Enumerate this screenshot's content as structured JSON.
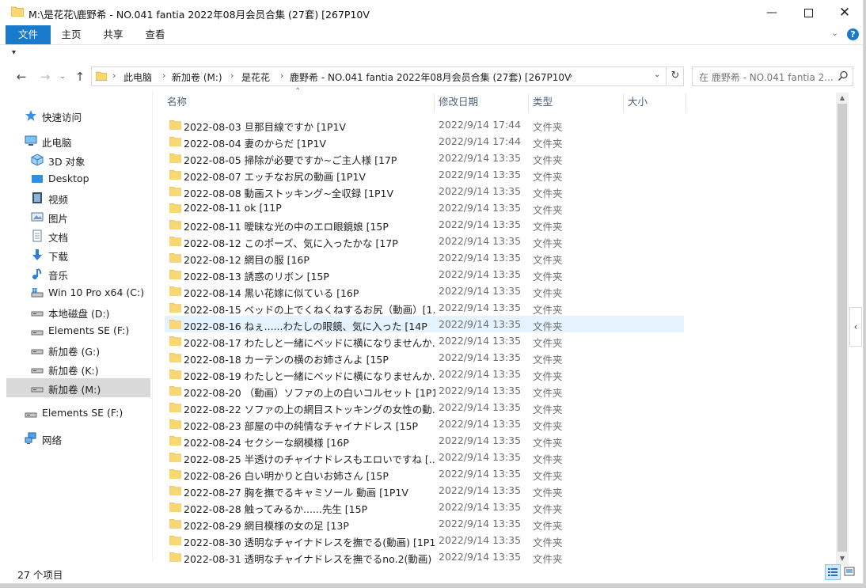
{
  "window": {
    "title": "M:\\是花花\\鹿野希 - NO.041 fantia 2022年08月会员合集 (27套) [267P10V"
  },
  "ribbon": {
    "tabs": [
      "文件",
      "主页",
      "共享",
      "查看"
    ],
    "accent_color": "#1979ca"
  },
  "address": {
    "crumbs": [
      "此电脑",
      "新加卷 (M:)",
      "是花花",
      "鹿野希 - NO.041 fantia 2022年08月会员合集 (27套) [267P10V"
    ]
  },
  "search": {
    "placeholder": "在 鹿野希 - NO.041 fantia 2..."
  },
  "sidebar": {
    "items": [
      {
        "label": "快速访问",
        "icon": "star-icon"
      },
      {
        "label": "此电脑",
        "icon": "computer-icon"
      },
      {
        "label": "3D 对象",
        "icon": "cube-icon"
      },
      {
        "label": "Desktop",
        "icon": "desktop-icon"
      },
      {
        "label": "视频",
        "icon": "video-icon"
      },
      {
        "label": "图片",
        "icon": "picture-icon"
      },
      {
        "label": "文档",
        "icon": "document-icon"
      },
      {
        "label": "下载",
        "icon": "download-icon"
      },
      {
        "label": "音乐",
        "icon": "music-icon"
      },
      {
        "label": "Win 10 Pro x64 (C:)",
        "icon": "system-drive-icon"
      },
      {
        "label": "本地磁盘 (D:)",
        "icon": "drive-icon"
      },
      {
        "label": "Elements SE (F:)",
        "icon": "drive-icon"
      },
      {
        "label": "新加卷 (G:)",
        "icon": "drive-icon"
      },
      {
        "label": "新加卷 (K:)",
        "icon": "drive-icon"
      },
      {
        "label": "新加卷 (M:)",
        "icon": "drive-icon"
      },
      {
        "label": "Elements SE (F:)",
        "icon": "drive-icon"
      },
      {
        "label": "网络",
        "icon": "network-icon"
      }
    ],
    "selected_index": 14
  },
  "columns": {
    "name": "名称",
    "date": "修改日期",
    "type": "类型",
    "size": "大小"
  },
  "files": [
    {
      "name": "2022-08-03 旦那目線ですか [1P1V",
      "date": "2022/9/14 17:44",
      "type": "文件夹"
    },
    {
      "name": "2022-08-04 妻のからだ [1P1V",
      "date": "2022/9/14 17:44",
      "type": "文件夹"
    },
    {
      "name": "2022-08-05 掃除が必要ですか~ご主人様 [17P",
      "date": "2022/9/14 13:35",
      "type": "文件夹"
    },
    {
      "name": "2022-08-07 エッチなお尻の動画 [1P1V",
      "date": "2022/9/14 13:35",
      "type": "文件夹"
    },
    {
      "name": "2022-08-08 動画ストッキング~全収録 [1P1V",
      "date": "2022/9/14 13:35",
      "type": "文件夹"
    },
    {
      "name": "2022-08-11 ok [11P",
      "date": "2022/9/14 13:35",
      "type": "文件夹"
    },
    {
      "name": "2022-08-11 曖昧な光の中のエロ眼鏡娘 [15P",
      "date": "2022/9/14 13:35",
      "type": "文件夹"
    },
    {
      "name": "2022-08-12 このポーズ、気に入ったかな [17P",
      "date": "2022/9/14 13:35",
      "type": "文件夹"
    },
    {
      "name": "2022-08-12 網目の服 [16P",
      "date": "2022/9/14 13:35",
      "type": "文件夹"
    },
    {
      "name": "2022-08-13 誘惑のリボン [15P",
      "date": "2022/9/14 13:35",
      "type": "文件夹"
    },
    {
      "name": "2022-08-14 黒い花嫁に似ている [16P",
      "date": "2022/9/14 13:35",
      "type": "文件夹"
    },
    {
      "name": "2022-08-15 ベッドの上でくねくねするお尻（動画）[1...",
      "date": "2022/9/14 13:35",
      "type": "文件夹"
    },
    {
      "name": "2022-08-16 ねぇ......わたしの眼鏡、気に入った [14P",
      "date": "2022/9/14 13:35",
      "type": "文件夹"
    },
    {
      "name": "2022-08-17 わたしと一緒にベッドに横になりませんか...",
      "date": "2022/9/14 13:35",
      "type": "文件夹"
    },
    {
      "name": "2022-08-18 カーテンの横のお姉さんよ [15P",
      "date": "2022/9/14 13:35",
      "type": "文件夹"
    },
    {
      "name": "2022-08-19 わたしと一緒にベッドに横になりませんか...",
      "date": "2022/9/14 13:35",
      "type": "文件夹"
    },
    {
      "name": "2022-08-20 （動画）ソファの上の白いコルセット [1P1V",
      "date": "2022/9/14 13:35",
      "type": "文件夹"
    },
    {
      "name": "2022-08-22 ソファの上の網目ストッキングの女性の動...",
      "date": "2022/9/14 13:35",
      "type": "文件夹"
    },
    {
      "name": "2022-08-23 部屋の中の純情なチャイナドレス [15P",
      "date": "2022/9/14 13:35",
      "type": "文件夹"
    },
    {
      "name": "2022-08-24 セクシーな網模様 [16P",
      "date": "2022/9/14 13:35",
      "type": "文件夹"
    },
    {
      "name": "2022-08-25 半透けのチャイナドレスもエロいですね [...",
      "date": "2022/9/14 13:35",
      "type": "文件夹"
    },
    {
      "name": "2022-08-26 白い明かりと白いお姉さん [15P",
      "date": "2022/9/14 13:35",
      "type": "文件夹"
    },
    {
      "name": "2022-08-27 胸を撫でるキャミソール 動画 [1P1V",
      "date": "2022/9/14 13:35",
      "type": "文件夹"
    },
    {
      "name": "2022-08-28 触ってみるか......先生 [15P",
      "date": "2022/9/14 13:35",
      "type": "文件夹"
    },
    {
      "name": "2022-08-29 網目模様の女の足 [13P",
      "date": "2022/9/14 13:35",
      "type": "文件夹"
    },
    {
      "name": "2022-08-30 透明なチャイナドレスを撫でる(動画) [1P1V",
      "date": "2022/9/14 13:35",
      "type": "文件夹"
    },
    {
      "name": "2022-08-31 透明なチャイナドレスを撫でるno.2(動画) ...",
      "date": "2022/9/14 13:35",
      "type": "文件夹"
    }
  ],
  "hover_row_index": 12,
  "status": {
    "item_count": "27 个项目"
  },
  "colors": {
    "folder": "#f8d775",
    "folder_dark": "#e3b34a",
    "hover_row": "#e5f3ff",
    "selected_nav": "#d9d9d9"
  }
}
